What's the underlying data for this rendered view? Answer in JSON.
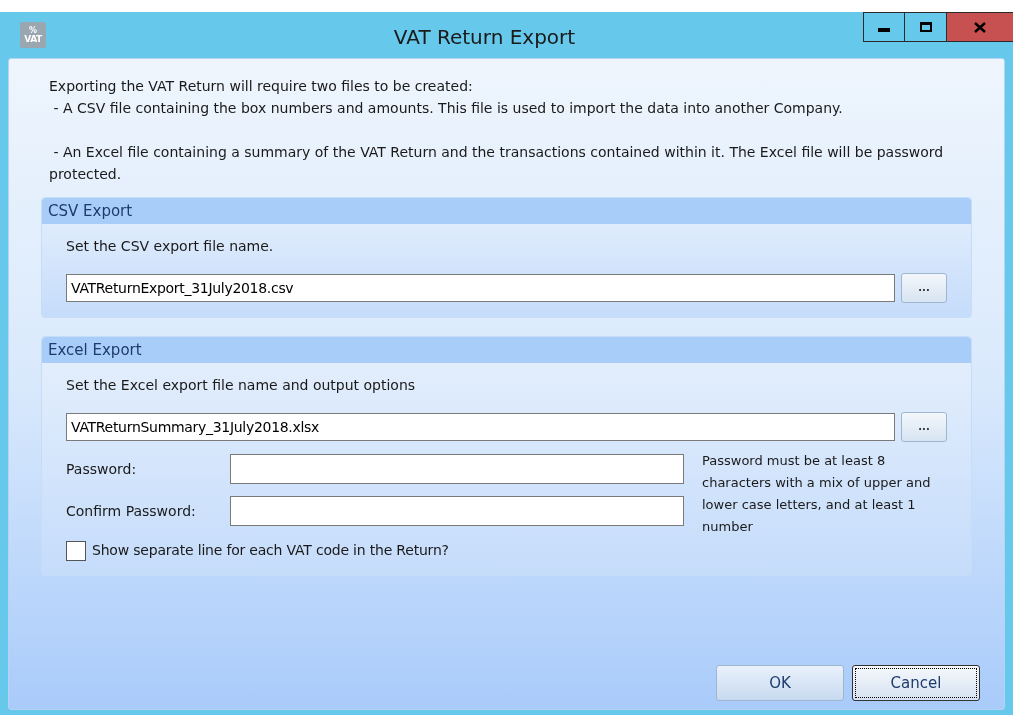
{
  "window": {
    "title": "VAT Return Export",
    "app_icon": {
      "symbol": "%",
      "label": "VAT"
    },
    "controls": [
      {
        "kind": "minimize"
      },
      {
        "kind": "maximize"
      },
      {
        "kind": "close"
      }
    ]
  },
  "intro": {
    "heading": "Exporting the VAT Return will require two files to be created:",
    "points": [
      " - A CSV file containing the box numbers and amounts. This file is used to import the data into another Company.",
      " - An Excel file containing a summary of the VAT Return and the transactions contained within it. The Excel file will be password protected."
    ]
  },
  "csv_export": {
    "title": "CSV Export",
    "instruction": "Set the CSV export file name.",
    "file_name": "VATReturnExport_31July2018.csv",
    "browse": "..."
  },
  "excel_export": {
    "title": "Excel Export",
    "instruction": "Set the Excel export file name and output options",
    "file_name": "VATReturnSummary_31July2018.xlsx",
    "browse": "...",
    "password": {
      "label": "Password:"
    },
    "confirm_password": {
      "label": "Confirm Password:"
    },
    "hint": "Password must be at least 8 characters with a mix of upper and lower case letters, and at least 1 number",
    "separate_lines": {
      "label": "Show separate line for each VAT code in the Return?",
      "checked": false
    }
  },
  "buttons": [
    {
      "label": "OK",
      "focused": false
    },
    {
      "label": "Cancel",
      "focused": true
    }
  ]
}
